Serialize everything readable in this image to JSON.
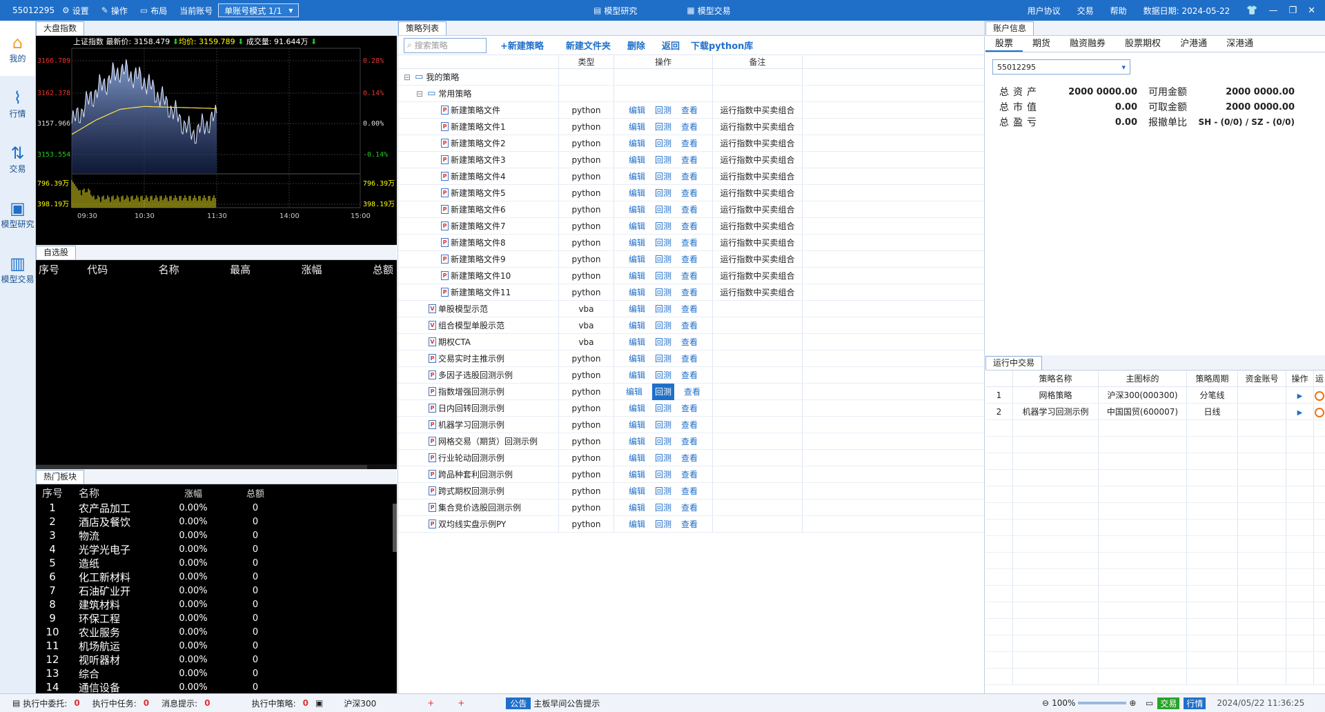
{
  "titlebar": {
    "account": "55012295",
    "settings": "设置",
    "operate": "操作",
    "layout": "布局",
    "cur_account": "当前账号",
    "mode": "单账号模式 1/1",
    "center_research": "模型研究",
    "center_trade": "模型交易",
    "user_agreement": "用户协议",
    "trade": "交易",
    "help": "帮助",
    "data_date": "数据日期: 2024-05-22"
  },
  "nav": [
    {
      "icon": "home-icon",
      "label": "我的"
    },
    {
      "icon": "chart-icon",
      "label": "行情"
    },
    {
      "icon": "trade-icon",
      "label": "交易"
    },
    {
      "icon": "research-icon",
      "label": "模型研究"
    },
    {
      "icon": "model-trade-icon",
      "label": "模型交易"
    }
  ],
  "market": {
    "tab": "大盘指数",
    "name": "上证指数",
    "latest_label": "最新价:",
    "latest": "3158.479",
    "avg_label": "均价:",
    "avg": "3159.789",
    "vol_label": "成交量:",
    "vol": "91.644万",
    "y_left": [
      "3166.789",
      "3162.378",
      "3157.966",
      "3153.554",
      "796.39万",
      "398.19万"
    ],
    "y_right": [
      "0.28%",
      "0.14%",
      "0.00%",
      "-0.14%",
      "796.39万",
      "398.19万"
    ],
    "x_ticks": [
      "09:30",
      "10:30",
      "11:30",
      "14:00",
      "15:00"
    ]
  },
  "chart_data": {
    "type": "line",
    "title": "上证指数",
    "x": [
      "09:30",
      "10:30",
      "11:30",
      "14:00",
      "15:00"
    ],
    "series": [
      {
        "name": "最新价",
        "values": [
          3157.5,
          3162,
          3165,
          3163.5,
          3160,
          3156,
          3158.5
        ]
      },
      {
        "name": "均价",
        "values": [
          3156,
          3158,
          3159.5,
          3159.9,
          3159.8,
          3159.7,
          3159.6
        ]
      }
    ],
    "ylim": [
      3150.5,
      3168
    ],
    "volume_ylim": [
      0,
      796.39
    ]
  },
  "fav": {
    "tab": "自选股",
    "cols": [
      "序号",
      "代码",
      "名称",
      "最高",
      "涨幅",
      "总额"
    ]
  },
  "hot": {
    "tab": "热门板块",
    "cols": [
      "序号",
      "名称",
      "涨幅",
      "总额"
    ],
    "rows": [
      [
        "1",
        "农产品加工",
        "0.00%",
        "0"
      ],
      [
        "2",
        "酒店及餐饮",
        "0.00%",
        "0"
      ],
      [
        "3",
        "物流",
        "0.00%",
        "0"
      ],
      [
        "4",
        "光学光电子",
        "0.00%",
        "0"
      ],
      [
        "5",
        "造纸",
        "0.00%",
        "0"
      ],
      [
        "6",
        "化工新材料",
        "0.00%",
        "0"
      ],
      [
        "7",
        "石油矿业开",
        "0.00%",
        "0"
      ],
      [
        "8",
        "建筑材料",
        "0.00%",
        "0"
      ],
      [
        "9",
        "环保工程",
        "0.00%",
        "0"
      ],
      [
        "10",
        "农业服务",
        "0.00%",
        "0"
      ],
      [
        "11",
        "机场航运",
        "0.00%",
        "0"
      ],
      [
        "12",
        "视听器材",
        "0.00%",
        "0"
      ],
      [
        "13",
        "综合",
        "0.00%",
        "0"
      ],
      [
        "14",
        "通信设备",
        "0.00%",
        "0"
      ]
    ]
  },
  "strat": {
    "tab": "策略列表",
    "search_placeholder": "搜索策略",
    "btn_new": "+新建策略",
    "btn_folder": "新建文件夹",
    "btn_delete": "删除",
    "btn_back": "返回",
    "btn_download": "下载python库",
    "cols": [
      "类型",
      "操作",
      "备注"
    ],
    "root": "我的策略",
    "group": "常用策略",
    "ops": [
      "编辑",
      "回测",
      "查看"
    ],
    "rows": [
      {
        "name": "新建策略文件",
        "type": "python",
        "note": "运行指数中买卖组合",
        "indent": 2,
        "icon": "P"
      },
      {
        "name": "新建策略文件1",
        "type": "python",
        "note": "运行指数中买卖组合",
        "indent": 2,
        "icon": "P"
      },
      {
        "name": "新建策略文件2",
        "type": "python",
        "note": "运行指数中买卖组合",
        "indent": 2,
        "icon": "P"
      },
      {
        "name": "新建策略文件3",
        "type": "python",
        "note": "运行指数中买卖组合",
        "indent": 2,
        "icon": "P"
      },
      {
        "name": "新建策略文件4",
        "type": "python",
        "note": "运行指数中买卖组合",
        "indent": 2,
        "icon": "P"
      },
      {
        "name": "新建策略文件5",
        "type": "python",
        "note": "运行指数中买卖组合",
        "indent": 2,
        "icon": "P"
      },
      {
        "name": "新建策略文件6",
        "type": "python",
        "note": "运行指数中买卖组合",
        "indent": 2,
        "icon": "P"
      },
      {
        "name": "新建策略文件7",
        "type": "python",
        "note": "运行指数中买卖组合",
        "indent": 2,
        "icon": "P"
      },
      {
        "name": "新建策略文件8",
        "type": "python",
        "note": "运行指数中买卖组合",
        "indent": 2,
        "icon": "P"
      },
      {
        "name": "新建策略文件9",
        "type": "python",
        "note": "运行指数中买卖组合",
        "indent": 2,
        "icon": "P"
      },
      {
        "name": "新建策略文件10",
        "type": "python",
        "note": "运行指数中买卖组合",
        "indent": 2,
        "icon": "P"
      },
      {
        "name": "新建策略文件11",
        "type": "python",
        "note": "运行指数中买卖组合",
        "indent": 2,
        "icon": "P"
      },
      {
        "name": "单股模型示范",
        "type": "vba",
        "note": "",
        "indent": 1,
        "icon": "V"
      },
      {
        "name": "组合模型单股示范",
        "type": "vba",
        "note": "",
        "indent": 1,
        "icon": "V"
      },
      {
        "name": "期权CTA",
        "type": "vba",
        "note": "",
        "indent": 1,
        "icon": "V"
      },
      {
        "name": "交易实时主推示例",
        "type": "python",
        "note": "",
        "indent": 1,
        "icon": "P"
      },
      {
        "name": "多因子选股回测示例",
        "type": "python",
        "note": "",
        "indent": 1,
        "icon": "P"
      },
      {
        "name": "指数增强回测示例",
        "type": "python",
        "note": "",
        "indent": 1,
        "icon": "P",
        "hl": true
      },
      {
        "name": "日内回转回测示例",
        "type": "python",
        "note": "",
        "indent": 1,
        "icon": "P"
      },
      {
        "name": "机器学习回测示例",
        "type": "python",
        "note": "",
        "indent": 1,
        "icon": "P"
      },
      {
        "name": "网格交易（期货）回测示例",
        "type": "python",
        "note": "",
        "indent": 1,
        "icon": "P"
      },
      {
        "name": "行业轮动回测示例",
        "type": "python",
        "note": "",
        "indent": 1,
        "icon": "P"
      },
      {
        "name": "跨品种套利回测示例",
        "type": "python",
        "note": "",
        "indent": 1,
        "icon": "P"
      },
      {
        "name": "跨式期权回测示例",
        "type": "python",
        "note": "",
        "indent": 1,
        "icon": "P"
      },
      {
        "name": "集合竞价选股回测示例",
        "type": "python",
        "note": "",
        "indent": 1,
        "icon": "P"
      },
      {
        "name": "双均线实盘示例PY",
        "type": "python",
        "note": "",
        "indent": 1,
        "icon": "P"
      }
    ]
  },
  "acct": {
    "tab": "账户信息",
    "tabs": [
      "股票",
      "期货",
      "融资融券",
      "股票期权",
      "沪港通",
      "深港通"
    ],
    "account": "55012295",
    "info": [
      [
        "总资产",
        "2000 0000.00",
        "可用金额",
        "2000 0000.00"
      ],
      [
        "总市值",
        "0.00",
        "可取金额",
        "2000 0000.00"
      ],
      [
        "总盈亏",
        "0.00",
        "报撤单比",
        "SH - (0/0) / SZ - (0/0)"
      ]
    ]
  },
  "run": {
    "tab": "运行中交易",
    "cols": [
      "",
      "策略名称",
      "主图标的",
      "策略周期",
      "资金账号",
      "操作",
      "运"
    ],
    "rows": [
      [
        "1",
        "网格策略",
        "沪深300(000300)",
        "分笔线",
        ""
      ],
      [
        "2",
        "机器学习回测示例",
        "中国国贸(600007)",
        "日线",
        ""
      ]
    ]
  },
  "status": {
    "entrust": "执行中委托:",
    "entrust_n": "0",
    "task": "执行中任务:",
    "task_n": "0",
    "msg": "消息提示:",
    "msg_n": "0",
    "strat": "执行中策略:",
    "strat_n": "0",
    "index": "沪深300",
    "notice": "公告",
    "notice_text": "主板早间公告提示",
    "zoom": "100%",
    "trade": "交易",
    "quote": "行情",
    "datetime": "2024/05/22 11:36:25"
  }
}
